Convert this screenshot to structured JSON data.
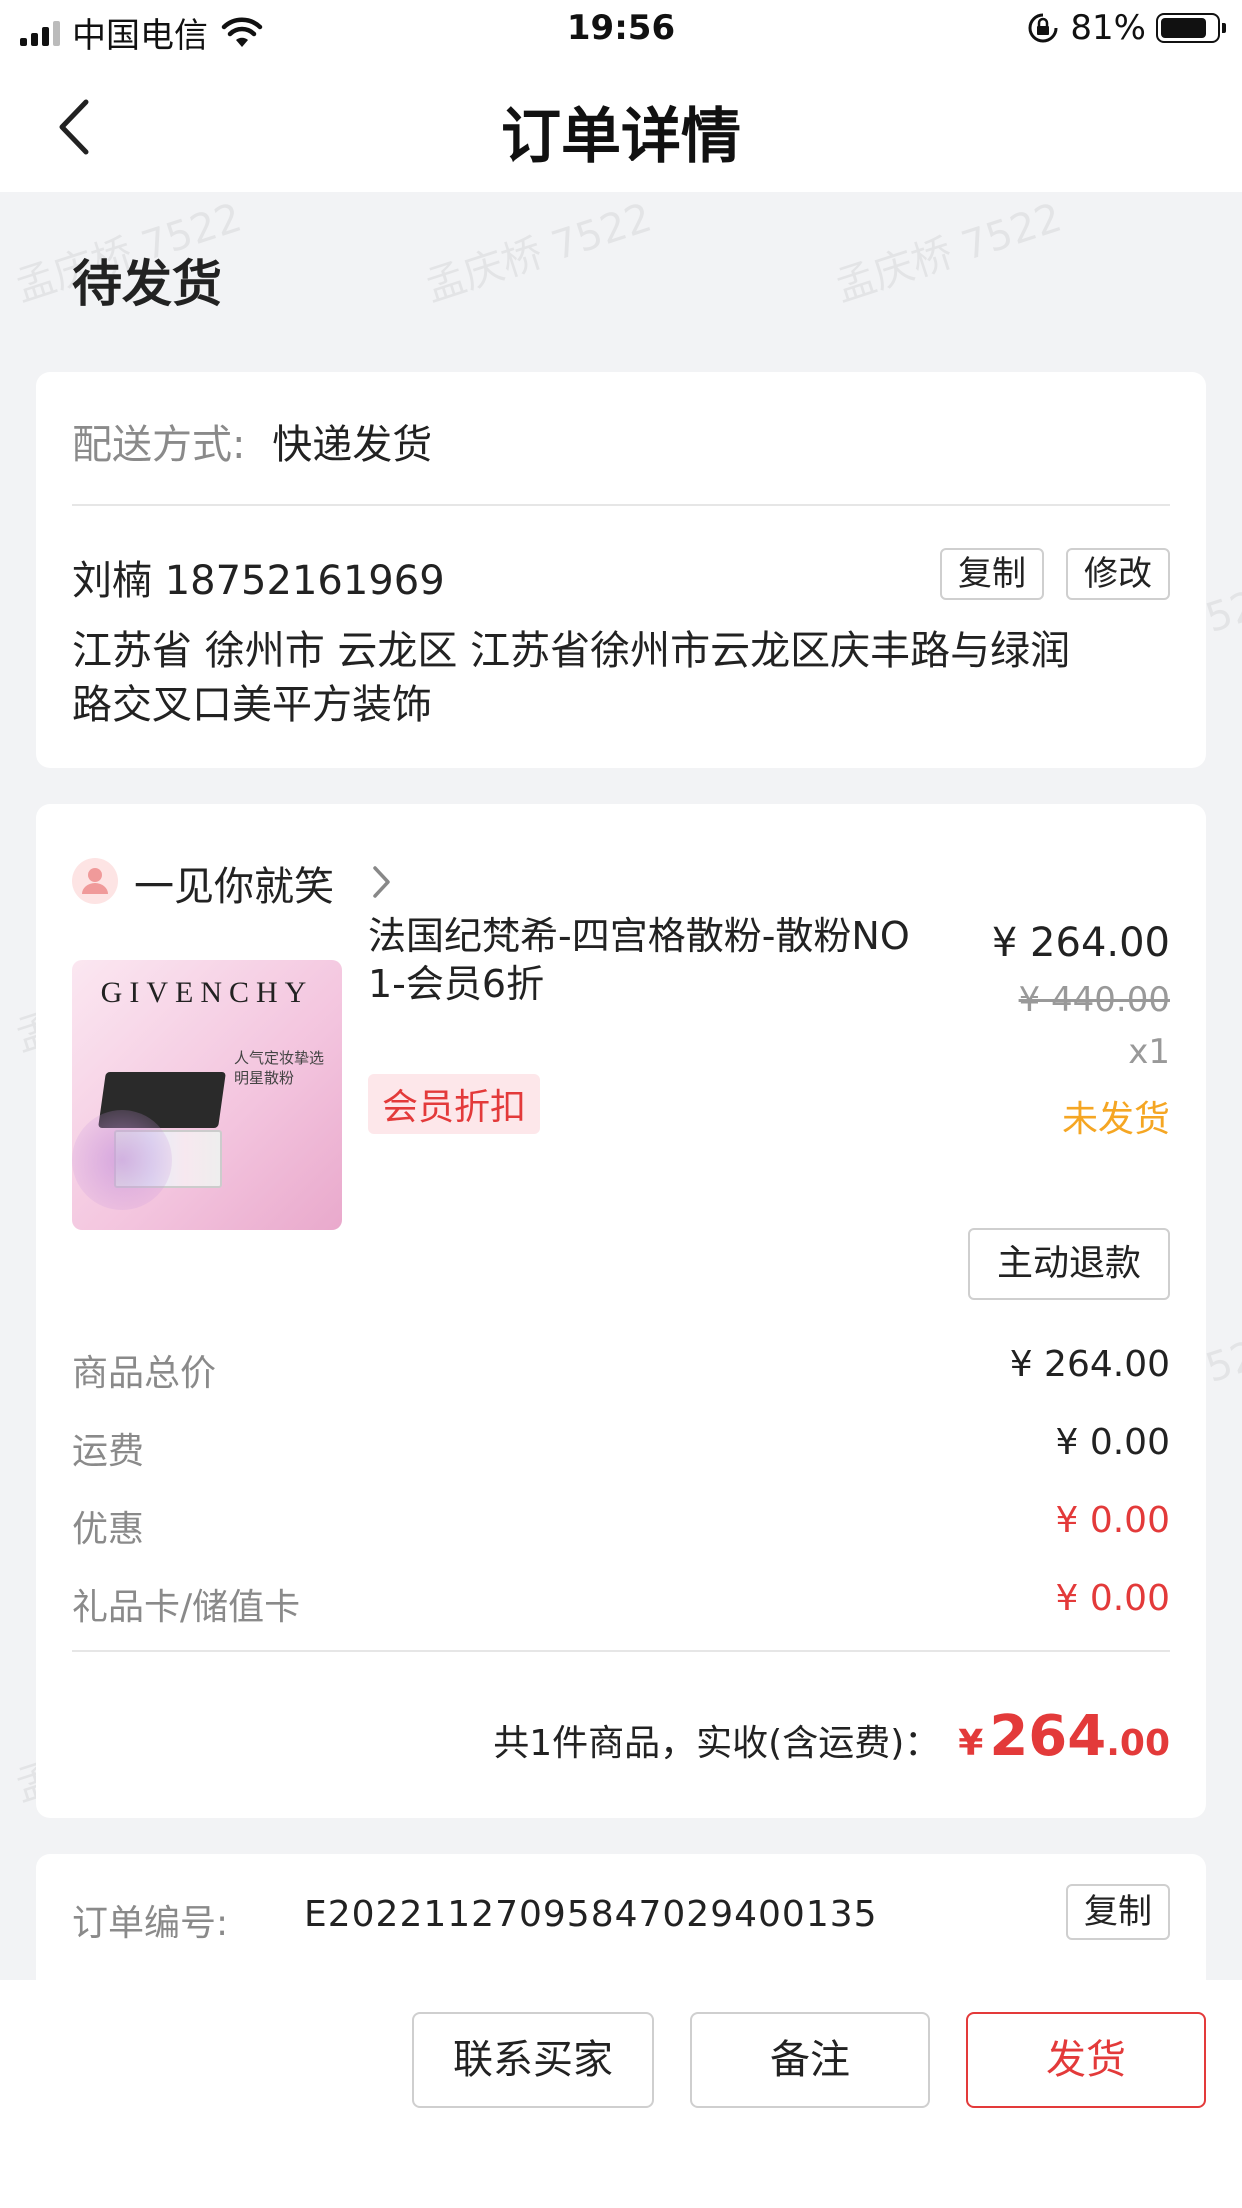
{
  "status_bar": {
    "carrier": "中国电信",
    "time": "19:56",
    "battery_percent": "81%",
    "battery_level": 0.81
  },
  "nav": {
    "title": "订单详情",
    "back_icon": "chevron-left-icon"
  },
  "order_status": "待发货",
  "delivery": {
    "label": "配送方式:",
    "value": "快递发货",
    "recipient": "刘楠 18752161969",
    "copy_label": "复制",
    "edit_label": "修改",
    "address_line1": "江苏省 徐州市 云龙区 江苏省徐州市云龙区庆丰路与绿润",
    "address_line2": "路交叉口美平方装饰"
  },
  "shop": {
    "name": "一见你就笑",
    "avatar_icon": "user-avatar-icon"
  },
  "product": {
    "image_brand": "GIVENCHY",
    "image_caption": "人气定妆挚选 明星散粉",
    "title_line1": "法国纪梵希-四宫格散粉-散粉NO",
    "title_line2": "1-会员6折",
    "tag": "会员折扣",
    "price": "¥ 264.00",
    "original_price": "¥ 440.00",
    "quantity": "x1",
    "ship_status": "未发货",
    "refund_label": "主动退款"
  },
  "summary": {
    "rows": [
      {
        "label": "商品总价",
        "value": "¥ 264.00"
      },
      {
        "label": "运费",
        "value": "¥ 0.00"
      },
      {
        "label": "优惠",
        "value": "¥ 0.00"
      },
      {
        "label": "礼品卡/储值卡",
        "value": "¥ 0.00"
      }
    ],
    "total_prefix": "共1件商品，实收(含运费)：",
    "total_currency": "¥",
    "total_integer": "264",
    "total_decimal": ".00"
  },
  "order_info": {
    "label": "订单编号:",
    "value": "E20221127095847029400135",
    "copy_label": "复制"
  },
  "bottom_bar": {
    "contact_label": "联系买家",
    "note_label": "备注",
    "ship_label": "发货"
  },
  "watermark_text": "孟庆桥 7522",
  "colors": {
    "accent_red": "#e33a3a",
    "status_orange": "#f5a623",
    "page_bg": "#f2f3f5"
  }
}
